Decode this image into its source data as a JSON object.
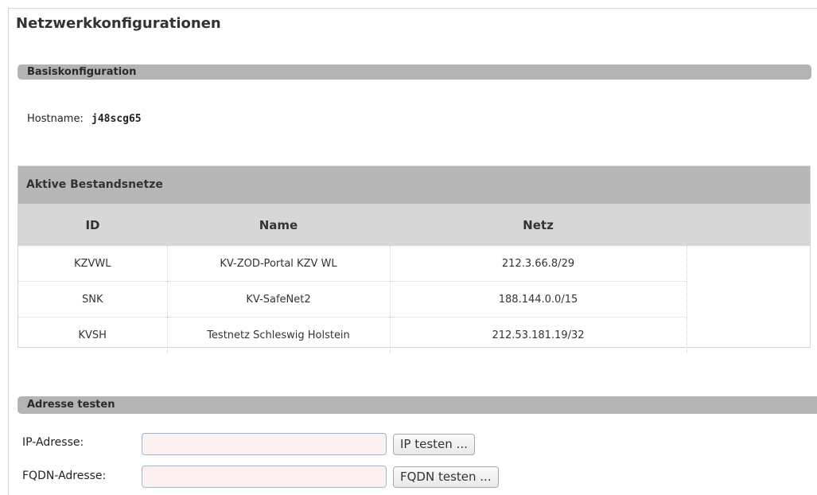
{
  "page": {
    "title": "Netzwerkkonfigurationen"
  },
  "basis": {
    "header": "Basiskonfiguration",
    "hostname_label": "Hostname:",
    "hostname_value": "j48scg65"
  },
  "netze": {
    "header": "Aktive Bestandsnetze",
    "columns": [
      "ID",
      "Name",
      "Netz"
    ],
    "rows": [
      {
        "id": "KZVWL",
        "name": "KV-ZOD-Portal KZV WL",
        "netz": "212.3.66.8/29"
      },
      {
        "id": "SNK",
        "name": "KV-SafeNet2",
        "netz": "188.144.0.0/15"
      },
      {
        "id": "KVSH",
        "name": "Testnetz Schleswig Holstein",
        "netz": "212.53.181.19/32"
      }
    ]
  },
  "test": {
    "header": "Adresse testen",
    "ip_label": "IP-Adresse:",
    "ip_value": "",
    "ip_button": "IP testen ...",
    "fqdn_label": "FQDN-Adresse:",
    "fqdn_value": "",
    "fqdn_button": "FQDN testen ..."
  },
  "colors": {
    "section_bar": "#b4b4b4",
    "table_header": "#d7d7d7",
    "input_bg": "#fdf0f0",
    "input_border": "#9db7d8"
  }
}
